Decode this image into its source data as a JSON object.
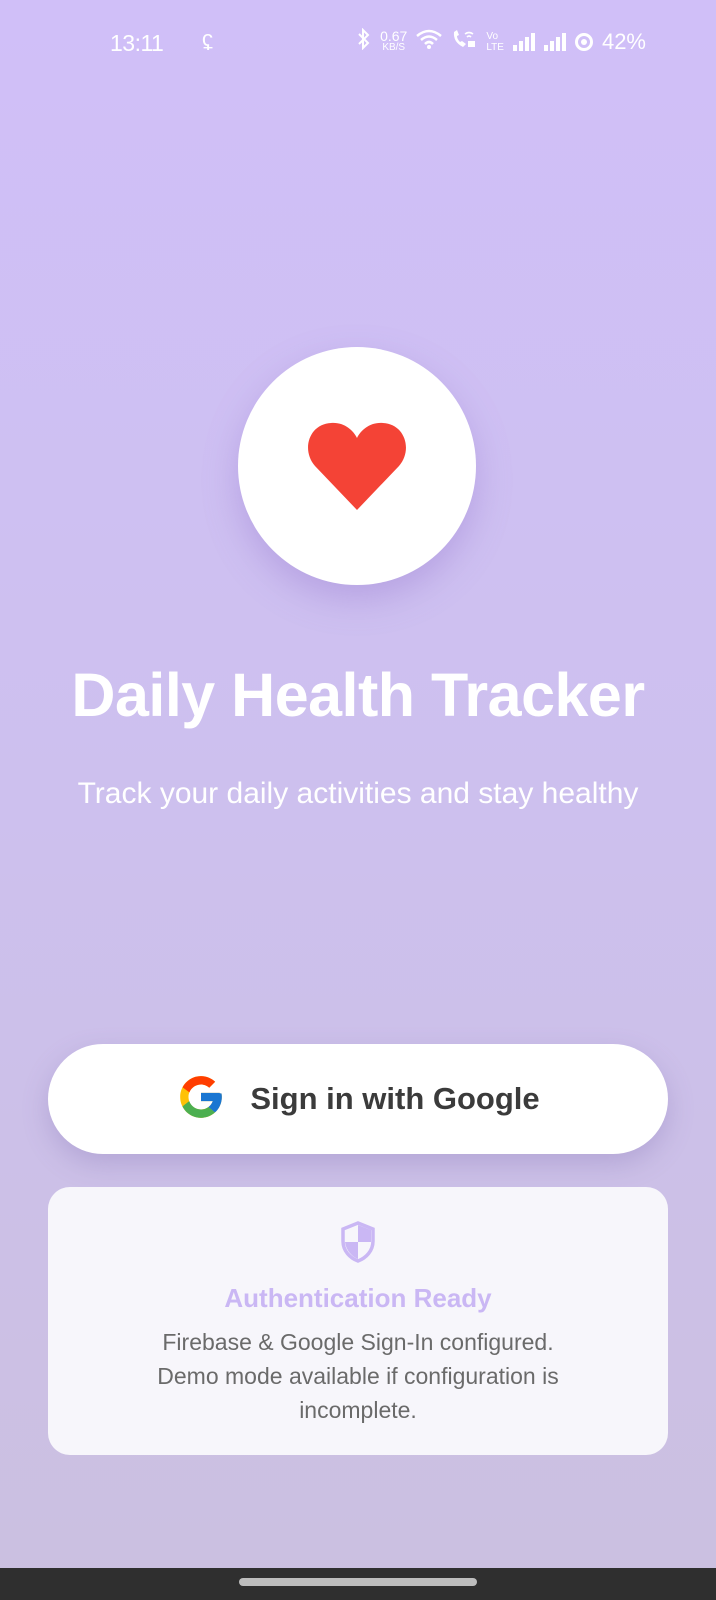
{
  "status_bar": {
    "time": "13:11",
    "net_speed_value": "0.67",
    "net_speed_unit": "KB/S",
    "volte_top": "Vo",
    "volte_bottom": "LTE",
    "battery": "42%"
  },
  "app": {
    "title": "Daily Health Tracker",
    "subtitle": "Track your daily activities and stay healthy",
    "heart_color": "#f44336"
  },
  "sign_in": {
    "label": "Sign in with Google"
  },
  "auth_card": {
    "title": "Authentication Ready",
    "line1": "Firebase & Google Sign-In configured.",
    "line2": "Demo mode available if configuration is",
    "line3": "incomplete."
  },
  "icons": [
    "bluetooth-icon",
    "wifi-icon",
    "wifi-calling-icon",
    "signal-icon",
    "battery-icon",
    "heart-icon",
    "google-logo-icon",
    "shield-icon"
  ],
  "colors": {
    "accent": "#cab7f4",
    "background_top": "#d0bff8",
    "background_bottom": "#cbc0e0"
  }
}
